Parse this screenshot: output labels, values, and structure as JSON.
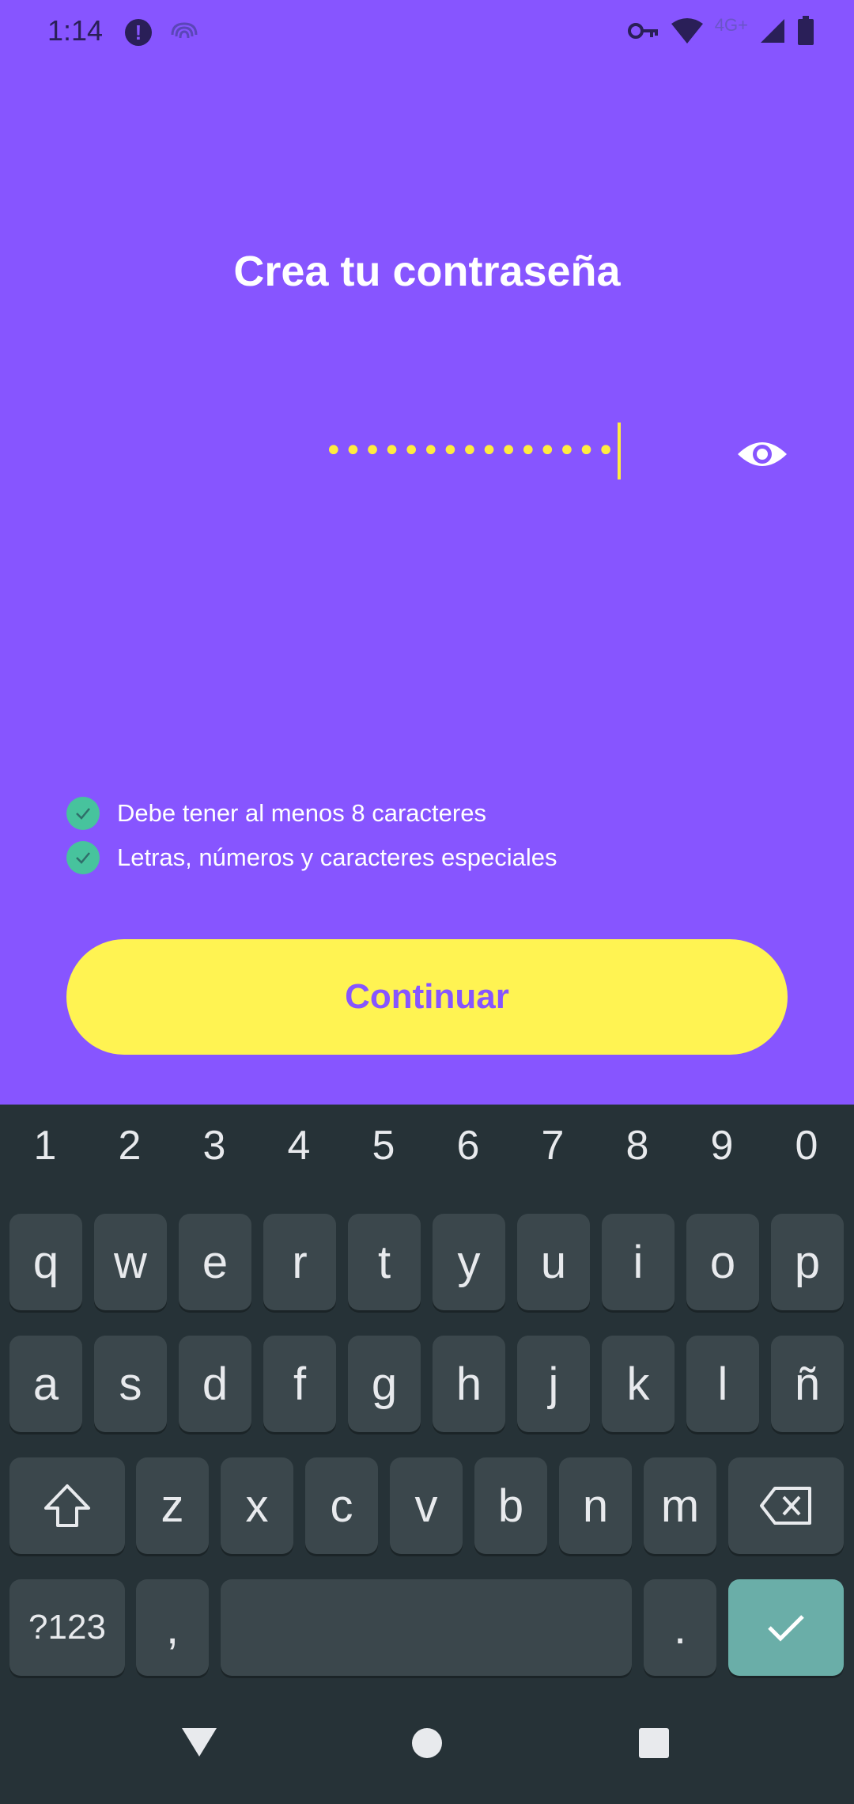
{
  "status_bar": {
    "time": "1:14",
    "network": "4G+"
  },
  "title": "Crea tu contraseña",
  "password": {
    "masked_value": "•••••••••••••••"
  },
  "requirements": [
    {
      "text": "Debe tener al menos 8 caracteres"
    },
    {
      "text": "Letras, números y caracteres especiales"
    }
  ],
  "continue_label": "Continuar",
  "keyboard": {
    "numbers": [
      "1",
      "2",
      "3",
      "4",
      "5",
      "6",
      "7",
      "8",
      "9",
      "0"
    ],
    "row1": [
      "q",
      "w",
      "e",
      "r",
      "t",
      "y",
      "u",
      "i",
      "o",
      "p"
    ],
    "row2": [
      "a",
      "s",
      "d",
      "f",
      "g",
      "h",
      "j",
      "k",
      "l",
      "ñ"
    ],
    "row3": [
      "z",
      "x",
      "c",
      "v",
      "b",
      "n",
      "m"
    ],
    "symbols_label": "?123",
    "comma": ",",
    "period": "."
  },
  "colors": {
    "background": "#8755ff",
    "accent_yellow": "#fff352",
    "check_green": "#47c39d",
    "keyboard_bg": "#263237",
    "key_bg": "#3b474c",
    "done_key": "#6aaea8"
  },
  "icons": [
    "alert-icon",
    "fingerprint-icon",
    "key-icon",
    "wifi-icon",
    "signal-icon",
    "battery-icon",
    "eye-icon",
    "check-icon",
    "shift-icon",
    "backspace-icon",
    "done-check-icon",
    "nav-back-icon",
    "nav-home-icon",
    "nav-recents-icon"
  ]
}
